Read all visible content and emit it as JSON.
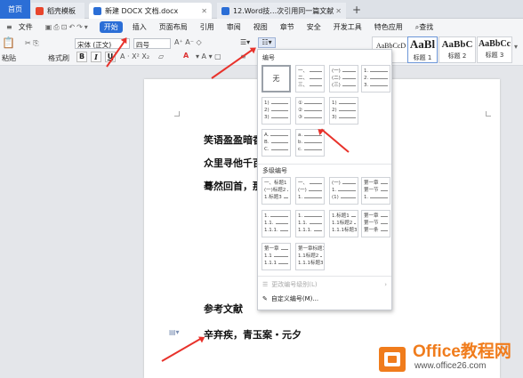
{
  "tabs": [
    {
      "label": "首页"
    },
    {
      "label": "稻壳模板"
    },
    {
      "label": "新建 DOCX 文档.docx"
    },
    {
      "label": "12.Word技…次引用同一篇文献"
    }
  ],
  "new_tab": "+",
  "menu": {
    "file": "文件",
    "items": [
      "开始",
      "插入",
      "页面布局",
      "引用",
      "审阅",
      "视图",
      "章节",
      "安全",
      "开发工具",
      "特色应用"
    ],
    "search": "查找"
  },
  "toolbar": {
    "paste": "粘贴",
    "format_painter": "格式刷",
    "font_name": "宋体 (正文)",
    "font_size": "四号",
    "bold": "B",
    "italic": "I",
    "underline": "U",
    "font_color": "A",
    "styles": [
      {
        "sample": "AaBbCcD",
        "caption": ""
      },
      {
        "sample": "AaBl",
        "caption": "标题 1"
      },
      {
        "sample": "AaBbC",
        "caption": "标题 2"
      },
      {
        "sample": "AaBbCc",
        "caption": "标题 3"
      }
    ]
  },
  "document": {
    "lines": [
      "笑语盈盈暗香",
      "众里寻他千百",
      "蓦然回首，那",
      "参考文献",
      "辛弃疾，青玉案・元夕"
    ]
  },
  "dropdown": {
    "section_numbering": "编号",
    "none_label": "无",
    "single": [
      [
        [
          "一、",
          "二、",
          "三、"
        ],
        [
          "(一)",
          "(二)",
          "(三)"
        ],
        [
          "1.",
          "2.",
          "3."
        ]
      ],
      [
        [
          "1)",
          "2)",
          "3)"
        ],
        [
          "①",
          "②",
          "③"
        ],
        [
          "1)",
          "2)",
          "3)"
        ]
      ],
      [
        [
          "A.",
          "B.",
          "C."
        ],
        [
          "a.",
          "b.",
          "c."
        ]
      ]
    ],
    "section_multilevel": "多级编号",
    "multi": [
      [
        [
          "一、标题1",
          "(一)标题2",
          "1.标题3"
        ],
        [
          "一、",
          "(一)",
          "1."
        ],
        [
          "(一)",
          "1.",
          "(1)"
        ],
        [
          "第一章",
          "第一节",
          "1."
        ]
      ],
      [
        [
          "1.",
          "1.1.",
          "1.1.1."
        ],
        [
          "1.",
          "1.1.",
          "1.1.1."
        ],
        [
          "1.标题1",
          "1.1标题2",
          "1.1.1标题3"
        ],
        [
          "第一章",
          "第一节",
          "第一条"
        ]
      ],
      [
        [
          "第一章",
          "1.1",
          "1.1.1"
        ],
        [
          "第一章标题1",
          "1.1标题2",
          "1.1.1标题3"
        ]
      ]
    ],
    "change_level": "更改编号级别(L)",
    "custom_number": "自定义编号(M)..."
  },
  "logo": {
    "brand": "Office教程网",
    "url": "www.office26.com"
  },
  "colors": {
    "accent": "#2b6ed6",
    "arrow": "#e8322b",
    "logo_orange": "#f07c1c"
  }
}
